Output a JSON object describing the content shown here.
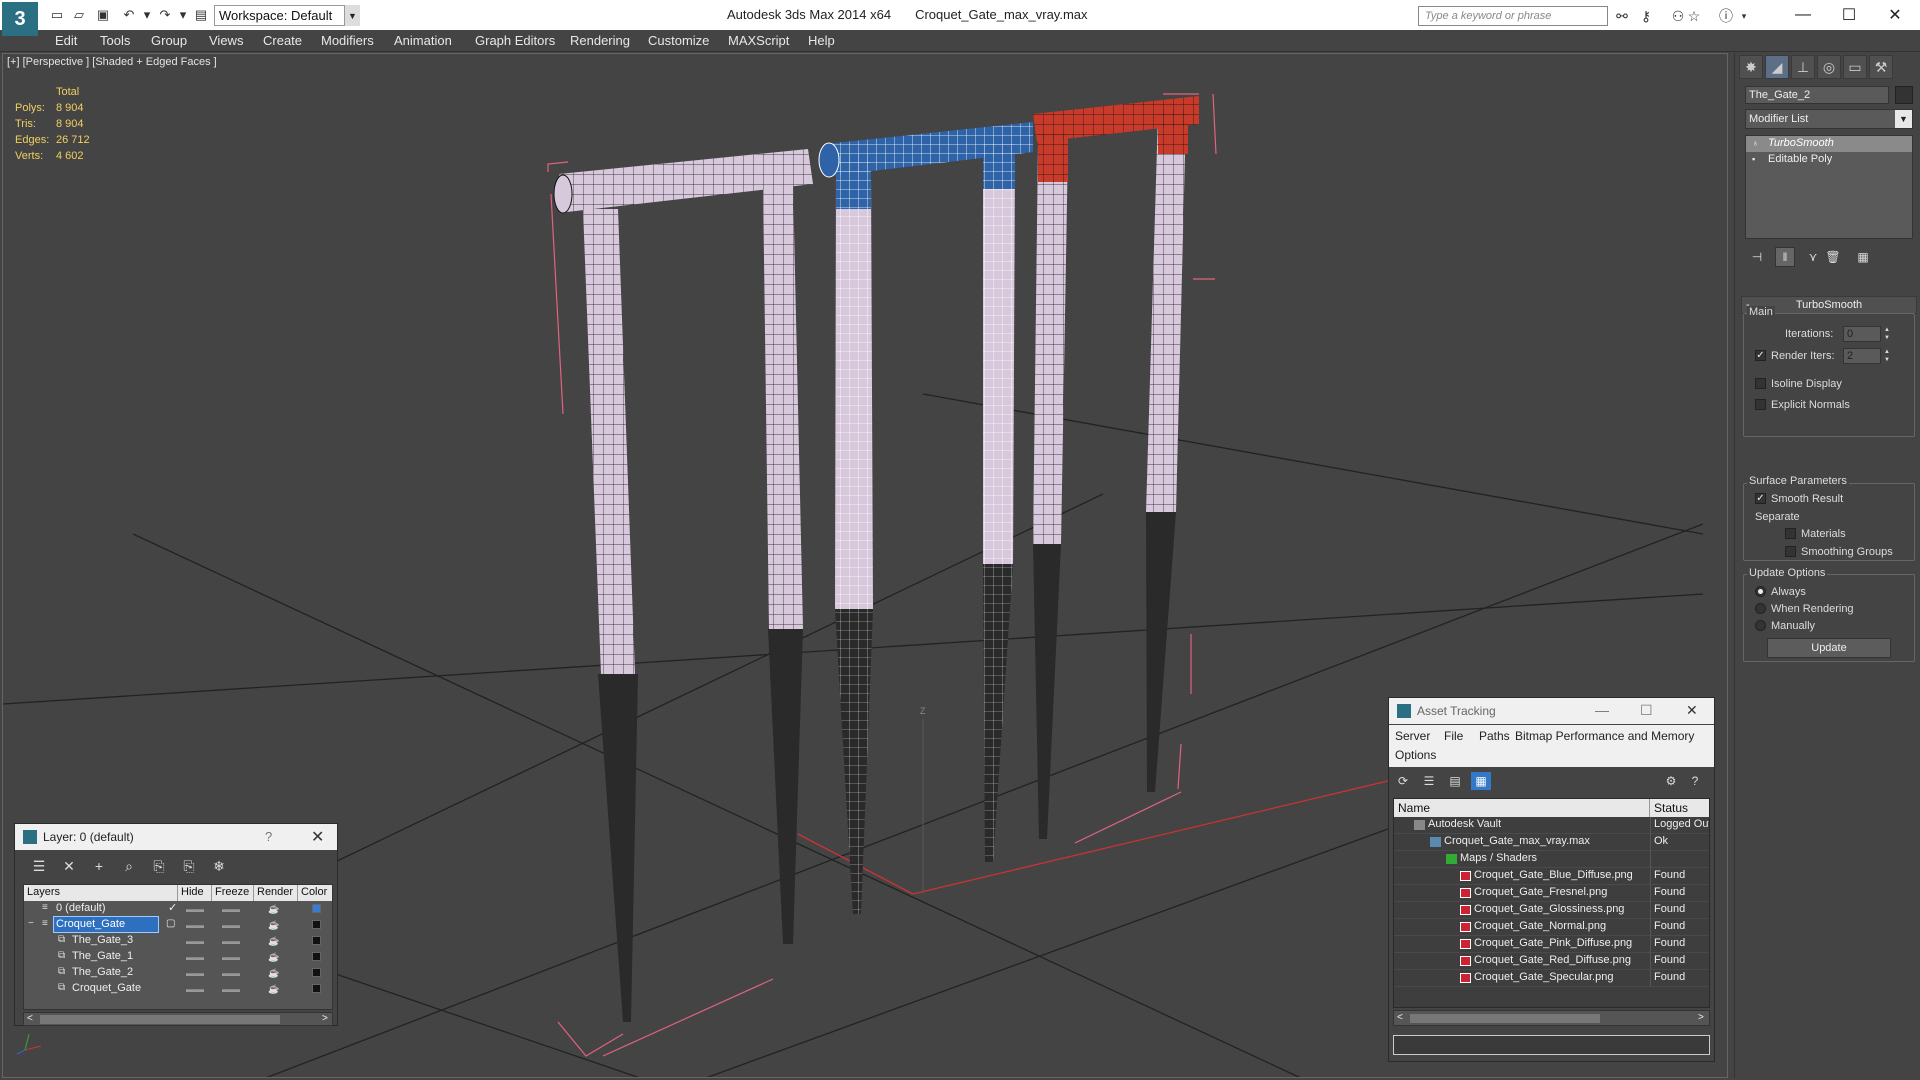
{
  "title_bar": {
    "app_name": "Autodesk 3ds Max  2014 x64",
    "file_name": "Croquet_Gate_max_vray.max",
    "workspace": "Workspace: Default",
    "search_placeholder": "Type a keyword or phrase"
  },
  "menu": [
    "Edit",
    "Tools",
    "Group",
    "Views",
    "Create",
    "Modifiers",
    "Animation",
    "Graph Editors",
    "Rendering",
    "Customize",
    "MAXScript",
    "Help"
  ],
  "viewport": {
    "label": "[+] [Perspective ] [Shaded + Edged Faces ]",
    "stats": {
      "header": "Total",
      "rows": [
        {
          "k": "Polys:",
          "v": "8 904"
        },
        {
          "k": "Tris:",
          "v": "8 904"
        },
        {
          "k": "Edges:",
          "v": "26 712"
        },
        {
          "k": "Verts:",
          "v": "4 602"
        }
      ]
    },
    "axis_label": "Z",
    "colors": {
      "pink": "#d8c8dc",
      "blue": "#2e63a8",
      "red": "#c83a2a",
      "stake": "#2a2a2a",
      "wire": "#111111",
      "selected_wire": "#ffffff",
      "bbox": "#e0637f",
      "grid": "#222222"
    }
  },
  "command_panel": {
    "object_name": "The_Gate_2",
    "modifier_list": "Modifier List",
    "stack": [
      {
        "label": "TurboSmooth",
        "selected": true
      },
      {
        "label": "Editable Poly",
        "selected": false
      }
    ],
    "rollout_title": "TurboSmooth",
    "main": {
      "group": "Main",
      "iterations_label": "Iterations:",
      "iterations_value": "0",
      "render_iters_label": "Render Iters:",
      "render_iters_value": "2",
      "render_iters_checked": true,
      "isoline_label": "Isoline Display",
      "explicit_normals_label": "Explicit Normals"
    },
    "surface": {
      "group": "Surface Parameters",
      "smooth_result_label": "Smooth Result",
      "separate_label": "Separate",
      "materials_label": "Materials",
      "smoothing_groups_label": "Smoothing Groups"
    },
    "update_options": {
      "group": "Update Options",
      "always": "Always",
      "when_rendering": "When Rendering",
      "manually": "Manually",
      "selected": "always",
      "update_button": "Update"
    }
  },
  "layer_dialog": {
    "title": "Layer: 0 (default)",
    "help": "?",
    "columns": [
      "Layers",
      "Hide",
      "Freeze",
      "Render",
      "Color"
    ],
    "rows": [
      {
        "name": "0 (default)",
        "indent": 0,
        "current": true,
        "selected": false,
        "color": "#3a7bd5"
      },
      {
        "name": "Croquet_Gate",
        "indent": 0,
        "current": false,
        "selected": true,
        "color": "#111111"
      },
      {
        "name": "The_Gate_3",
        "indent": 1,
        "current": false,
        "selected": false,
        "color": "#111111"
      },
      {
        "name": "The_Gate_1",
        "indent": 1,
        "current": false,
        "selected": false,
        "color": "#111111"
      },
      {
        "name": "The_Gate_2",
        "indent": 1,
        "current": false,
        "selected": false,
        "color": "#111111"
      },
      {
        "name": "Croquet_Gate",
        "indent": 1,
        "current": false,
        "selected": false,
        "color": "#111111"
      }
    ]
  },
  "asset_dialog": {
    "title": "Asset Tracking",
    "menu_row1": [
      "Server",
      "File",
      "Paths",
      "Bitmap Performance and Memory"
    ],
    "menu_row2": [
      "Options"
    ],
    "columns": [
      "Name",
      "Status"
    ],
    "rows": [
      {
        "name": "Autodesk Vault",
        "status": "Logged Out",
        "indent": 0,
        "icon": "vault"
      },
      {
        "name": "Croquet_Gate_max_vray.max",
        "status": "Ok",
        "indent": 1,
        "icon": "max"
      },
      {
        "name": "Maps / Shaders",
        "status": "",
        "indent": 2,
        "icon": "map"
      },
      {
        "name": "Croquet_Gate_Blue_Diffuse.png",
        "status": "Found",
        "indent": 3,
        "icon": "png"
      },
      {
        "name": "Croquet_Gate_Fresnel.png",
        "status": "Found",
        "indent": 3,
        "icon": "png"
      },
      {
        "name": "Croquet_Gate_Glossiness.png",
        "status": "Found",
        "indent": 3,
        "icon": "png"
      },
      {
        "name": "Croquet_Gate_Normal.png",
        "status": "Found",
        "indent": 3,
        "icon": "png"
      },
      {
        "name": "Croquet_Gate_Pink_Diffuse.png",
        "status": "Found",
        "indent": 3,
        "icon": "png"
      },
      {
        "name": "Croquet_Gate_Red_Diffuse.png",
        "status": "Found",
        "indent": 3,
        "icon": "png"
      },
      {
        "name": "Croquet_Gate_Specular.png",
        "status": "Found",
        "indent": 3,
        "icon": "png"
      }
    ]
  }
}
